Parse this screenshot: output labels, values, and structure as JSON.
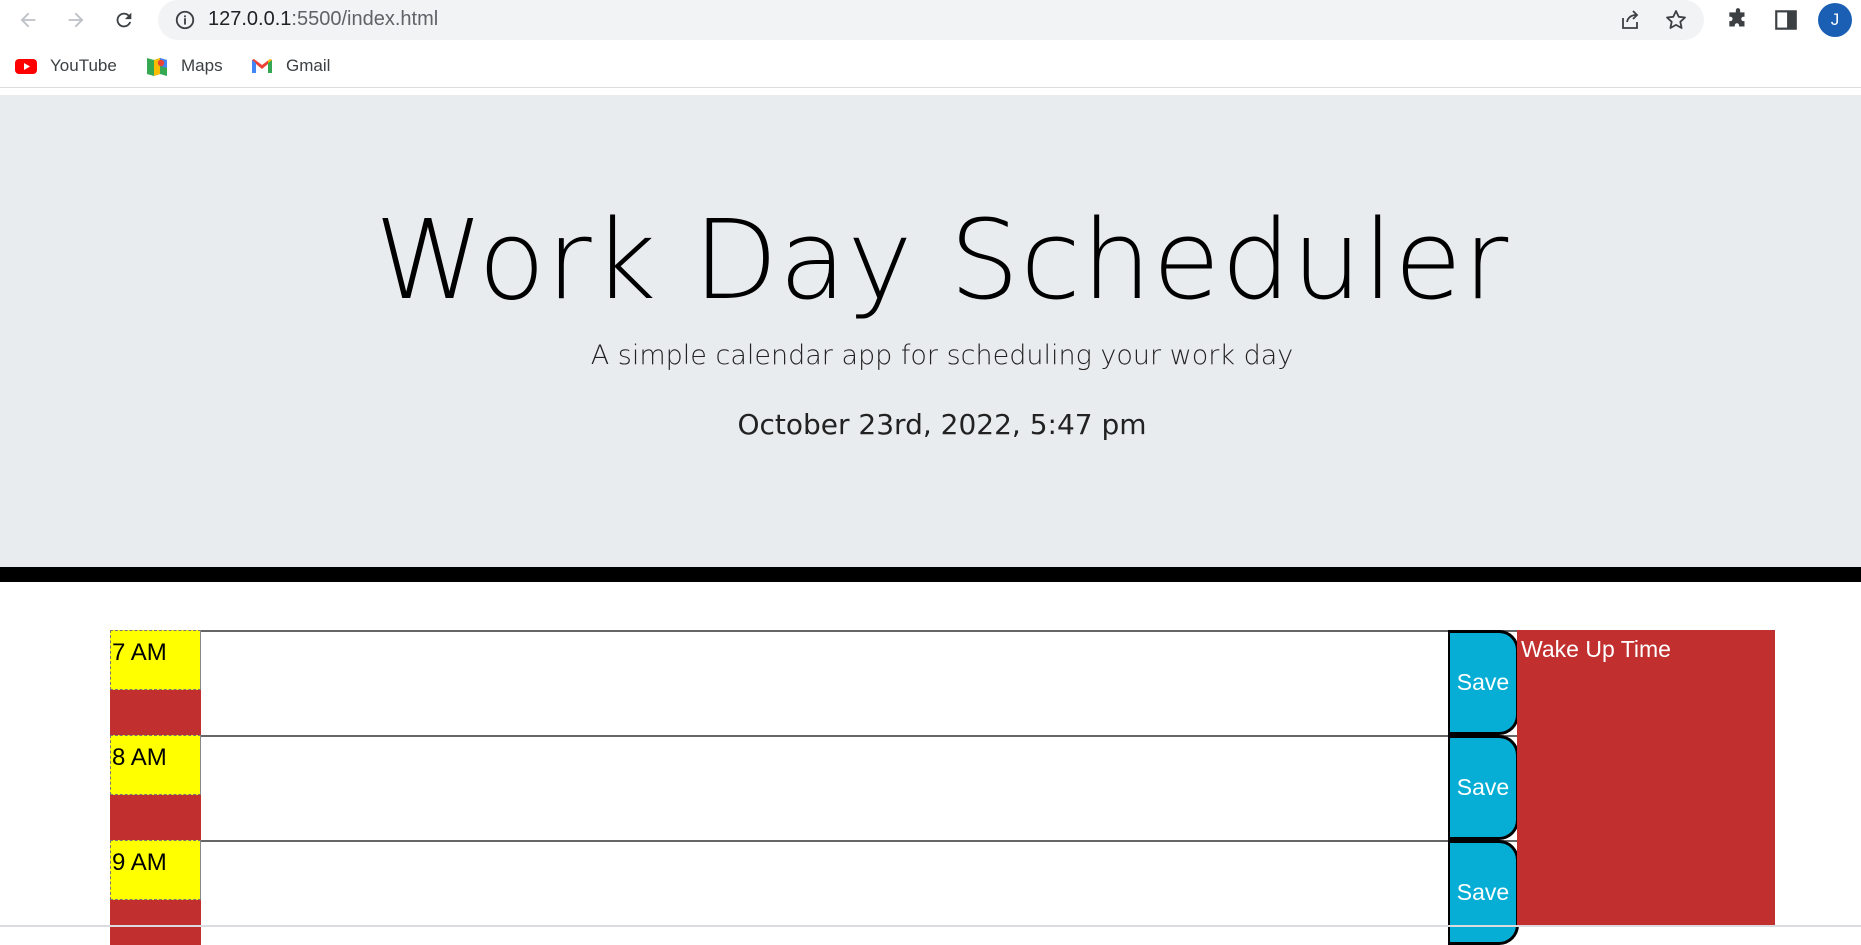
{
  "browser": {
    "url_host": "127.0.0.1",
    "url_path": ":5500/index.html",
    "profile_initial": "J",
    "bookmarks": [
      {
        "label": "YouTube"
      },
      {
        "label": "Maps"
      },
      {
        "label": "Gmail"
      }
    ]
  },
  "header": {
    "title": "Work Day Scheduler",
    "lead": "A simple calendar app for scheduling your work day",
    "current_date": "October 23rd, 2022, 5:47 pm"
  },
  "schedule": {
    "rows": [
      {
        "hour": "7 AM",
        "save_label": "Save"
      },
      {
        "hour": "8 AM",
        "save_label": "Save"
      },
      {
        "hour": "9 AM",
        "save_label": "Save"
      }
    ],
    "panel_text": "Wake Up Time"
  },
  "colors": {
    "jumbotron": "#e9ecef",
    "hour_label": "#ffff00",
    "past": "#c12f2f",
    "save": "#06aed5"
  }
}
